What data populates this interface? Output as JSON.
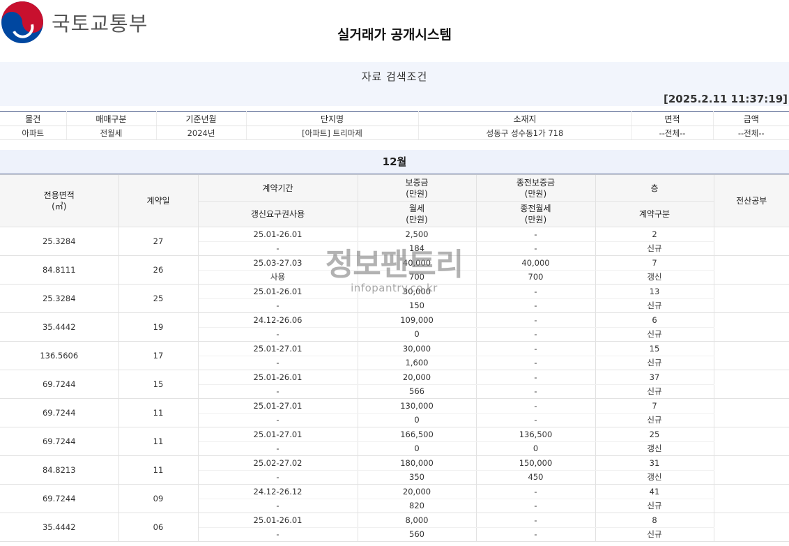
{
  "brand": {
    "name": "국토교통부",
    "logo_icon": "taegeuk-emblem-icon",
    "colors": {
      "red": "#c8102e",
      "blue": "#0047a0"
    }
  },
  "page_title": "실거래가 공개시스템",
  "search_conditions": {
    "title": "자료 검색조건",
    "timestamp": "[2025.2.11 11:37:19]",
    "headers": [
      "물건",
      "매매구분",
      "기준년월",
      "단지명",
      "소재지",
      "면적",
      "금액"
    ],
    "values": [
      "아파트",
      "전월세",
      "2024년",
      "[아파트] 트리마제",
      "성동구 성수동1가 718",
      "--전체--",
      "--전체--"
    ]
  },
  "month_label": "12월",
  "columns": {
    "area": "전용면적\n(㎡)",
    "contract_day": "계약일",
    "period": "계약기간",
    "renewal_right": "갱신요구권사용",
    "deposit": "보증금\n(만원)",
    "monthly_rent": "월세\n(만원)",
    "prev_deposit": "종전보증금\n(만원)",
    "prev_rent": "종전월세\n(만원)",
    "floor": "층",
    "contract_type": "계약구분",
    "registry": "전산공부"
  },
  "rows": [
    {
      "area": "25.3284",
      "day": "27",
      "period": "25.01-26.01",
      "renewal": "-",
      "deposit": "2,500",
      "rent": "184",
      "prev_deposit": "-",
      "prev_rent": "-",
      "floor": "2",
      "type": "신규"
    },
    {
      "area": "84.8111",
      "day": "26",
      "period": "25.03-27.03",
      "renewal": "사용",
      "deposit": "40,000",
      "rent": "700",
      "prev_deposit": "40,000",
      "prev_rent": "700",
      "floor": "7",
      "type": "갱신"
    },
    {
      "area": "25.3284",
      "day": "25",
      "period": "25.01-26.01",
      "renewal": "-",
      "deposit": "30,000",
      "rent": "150",
      "prev_deposit": "-",
      "prev_rent": "-",
      "floor": "13",
      "type": "신규"
    },
    {
      "area": "35.4442",
      "day": "19",
      "period": "24.12-26.06",
      "renewal": "-",
      "deposit": "109,000",
      "rent": "0",
      "prev_deposit": "-",
      "prev_rent": "-",
      "floor": "6",
      "type": "신규"
    },
    {
      "area": "136.5606",
      "day": "17",
      "period": "25.01-27.01",
      "renewal": "-",
      "deposit": "30,000",
      "rent": "1,600",
      "prev_deposit": "-",
      "prev_rent": "-",
      "floor": "15",
      "type": "신규"
    },
    {
      "area": "69.7244",
      "day": "15",
      "period": "25.01-26.01",
      "renewal": "-",
      "deposit": "20,000",
      "rent": "566",
      "prev_deposit": "-",
      "prev_rent": "-",
      "floor": "37",
      "type": "신규"
    },
    {
      "area": "69.7244",
      "day": "11",
      "period": "25.01-27.01",
      "renewal": "-",
      "deposit": "130,000",
      "rent": "0",
      "prev_deposit": "-",
      "prev_rent": "-",
      "floor": "7",
      "type": "신규"
    },
    {
      "area": "69.7244",
      "day": "11",
      "period": "25.01-27.01",
      "renewal": "-",
      "deposit": "166,500",
      "rent": "0",
      "prev_deposit": "136,500",
      "prev_rent": "0",
      "floor": "25",
      "type": "갱신"
    },
    {
      "area": "84.8213",
      "day": "11",
      "period": "25.02-27.02",
      "renewal": "-",
      "deposit": "180,000",
      "rent": "350",
      "prev_deposit": "150,000",
      "prev_rent": "450",
      "floor": "31",
      "type": "갱신"
    },
    {
      "area": "69.7244",
      "day": "09",
      "period": "24.12-26.12",
      "renewal": "-",
      "deposit": "20,000",
      "rent": "820",
      "prev_deposit": "-",
      "prev_rent": "-",
      "floor": "41",
      "type": "신규"
    },
    {
      "area": "35.4442",
      "day": "06",
      "period": "25.01-26.01",
      "renewal": "-",
      "deposit": "8,000",
      "rent": "560",
      "prev_deposit": "-",
      "prev_rent": "-",
      "floor": "8",
      "type": "신규"
    }
  ],
  "watermark": {
    "main": "정보팬트리",
    "sub": "infopantry.co.kr"
  }
}
